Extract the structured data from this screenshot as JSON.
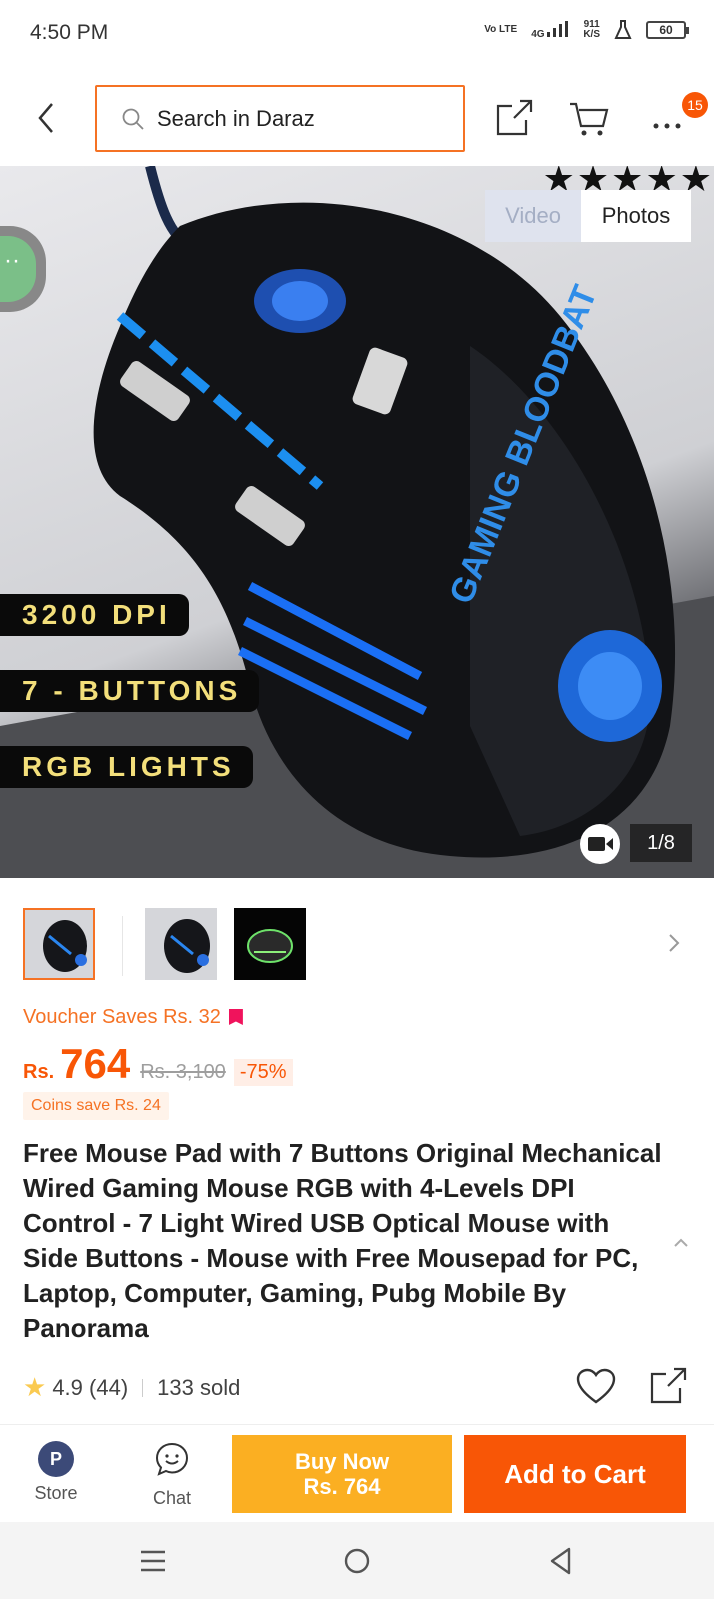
{
  "status_bar": {
    "time": "4:50 PM",
    "volte": "Vo LTE",
    "network": "4G",
    "speed_value": "911",
    "speed_unit": "K/S",
    "battery": "60"
  },
  "header": {
    "search_placeholder": "Search in Daraz",
    "cart_badge": "15"
  },
  "gallery": {
    "tabs": [
      "Video",
      "Photos"
    ],
    "active_tab": "Photos",
    "features": [
      "3200 DPI",
      "7 - BUTTONS",
      "RGB LIGHTS"
    ],
    "counter": "1/8",
    "mouse_text": "GAMING BLOODBAT"
  },
  "product": {
    "voucher": "Voucher Saves Rs. 32",
    "currency": "Rs.",
    "price": "764",
    "original_price": "Rs. 3,100",
    "discount": "-75%",
    "coins": "Coins save Rs. 24",
    "title": "Free Mouse Pad with 7 Buttons Original Mechanical Wired Gaming Mouse RGB with 4-Levels DPI Control - 7 Light Wired USB Optical Mouse with Side Buttons - Mouse with Free Mousepad for PC, Laptop, Computer, Gaming, Pubg Mobile By Panorama",
    "rating": "4.9",
    "reviews": "(44)",
    "sold": "133 sold"
  },
  "bottom_bar": {
    "store_label": "Store",
    "chat_label": "Chat",
    "buy_now_line1": "Buy Now",
    "buy_now_line2": "Rs. 764",
    "add_to_cart": "Add to Cart"
  },
  "colors": {
    "accent": "#f85606",
    "search_border": "#f57224",
    "buy_now": "#fbaf22",
    "rating_star": "#faca51"
  }
}
